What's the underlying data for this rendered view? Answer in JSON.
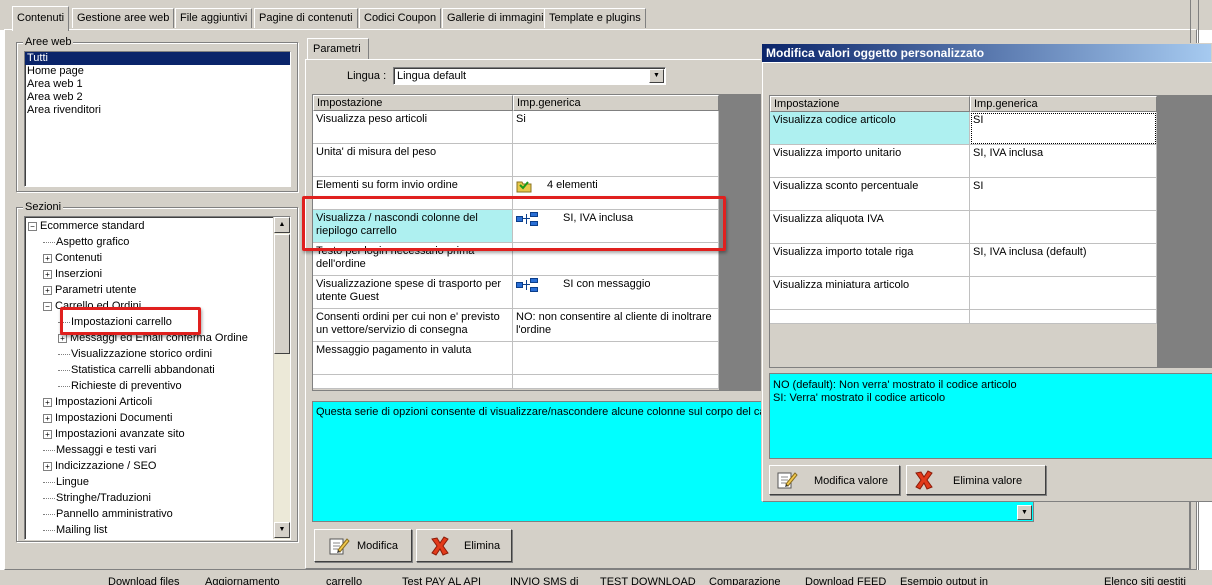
{
  "tabs": [
    "Contenuti",
    "Gestione aree web",
    "File aggiuntivi",
    "Pagine di contenuti",
    "Codici Coupon",
    "Gallerie di immagini",
    "Template e plugins"
  ],
  "aree_web": {
    "title": "Aree web",
    "items": [
      "Tutti",
      "Home page",
      "Area web 1",
      "Area web 2",
      "Area rivenditori"
    ]
  },
  "sezioni": {
    "title": "Sezioni",
    "items": [
      {
        "label": "Ecommerce standard",
        "level": 0,
        "exp": "−"
      },
      {
        "label": "Aspetto grafico",
        "level": 1,
        "exp": ""
      },
      {
        "label": "Contenuti",
        "level": 1,
        "exp": "+"
      },
      {
        "label": "Inserzioni",
        "level": 1,
        "exp": "+"
      },
      {
        "label": "Parametri utente",
        "level": 1,
        "exp": "+"
      },
      {
        "label": "Carrello ed Ordini",
        "level": 1,
        "exp": "−"
      },
      {
        "label": "Impostazioni carrello",
        "level": 2,
        "exp": ""
      },
      {
        "label": "Messaggi ed Email conferma Ordine",
        "level": 2,
        "exp": "+"
      },
      {
        "label": "Visualizzazione storico ordini",
        "level": 2,
        "exp": ""
      },
      {
        "label": "Statistica carrelli abbandonati",
        "level": 2,
        "exp": ""
      },
      {
        "label": "Richieste di preventivo",
        "level": 2,
        "exp": ""
      },
      {
        "label": "Impostazioni Articoli",
        "level": 1,
        "exp": "+"
      },
      {
        "label": "Impostazioni Documenti",
        "level": 1,
        "exp": "+"
      },
      {
        "label": "Impostazioni avanzate sito",
        "level": 1,
        "exp": "+"
      },
      {
        "label": "Messaggi e testi vari",
        "level": 1,
        "exp": ""
      },
      {
        "label": "Indicizzazione / SEO",
        "level": 1,
        "exp": "+"
      },
      {
        "label": "Lingue",
        "level": 1,
        "exp": ""
      },
      {
        "label": "Stringhe/Traduzioni",
        "level": 1,
        "exp": ""
      },
      {
        "label": "Pannello amministrativo",
        "level": 1,
        "exp": ""
      },
      {
        "label": "Mailing list",
        "level": 1,
        "exp": ""
      }
    ]
  },
  "parametri": {
    "tab": "Parametri",
    "lingua_label": "Lingua :",
    "lingua_value": "Lingua default",
    "col_impostazione": "Impostazione",
    "col_generica": "Imp.generica",
    "rows": [
      {
        "label": "Visualizza peso articoli",
        "value": "Si",
        "icon": ""
      },
      {
        "label": "Unita' di misura del peso",
        "value": "",
        "icon": ""
      },
      {
        "label": "Elementi su form invio ordine",
        "value": "4 elementi",
        "icon": "folder"
      },
      {
        "label": "Visualizza / nascondi colonne del riepilogo carrello",
        "value": "SI, IVA inclusa",
        "icon": "tree"
      },
      {
        "label": "Testo per login necessario prima dell'ordine",
        "value": "",
        "icon": ""
      },
      {
        "label": "Visualizzazione spese di trasporto per utente Guest",
        "value": "SI con messaggio",
        "icon": "tree"
      },
      {
        "label": "Consenti ordini per cui non e' previsto un vettore/servizio di consegna",
        "value": "NO: non consentire al cliente di inoltrare l'ordine",
        "icon": ""
      },
      {
        "label": "Messaggio pagamento in valuta",
        "value": "",
        "icon": ""
      }
    ],
    "description": "Questa serie di opzioni consente di visualizzare/nascondere alcune colonne sul corpo del carre",
    "btn_modifica": "Modifica",
    "btn_elimina": "Elimina"
  },
  "dialog": {
    "title": "Modifica valori oggetto personalizzato",
    "col_impostazione": "Impostazione",
    "col_generica": "Imp.generica",
    "rows": [
      {
        "label": "Visualizza codice articolo",
        "value": "SI"
      },
      {
        "label": "Visualizza importo unitario",
        "value": "SI, IVA inclusa"
      },
      {
        "label": "Visualizza sconto percentuale",
        "value": "SI"
      },
      {
        "label": "Visualizza aliquota IVA",
        "value": ""
      },
      {
        "label": "Visualizza importo totale riga",
        "value": "SI, IVA inclusa (default)"
      },
      {
        "label": "Visualizza miniatura articolo",
        "value": ""
      }
    ],
    "help_line1": "NO (default): Non verra' mostrato il codice articolo",
    "help_line2": "SI: Verra' mostrato il codice articolo",
    "btn_modifica": "Modifica valore",
    "btn_elimina": "Elimina valore"
  },
  "bottom_strip": [
    "Download files",
    "Aggiornamento",
    "carrello",
    "Test PAY AL API",
    "INVIO SMS di",
    "TEST DOWNLOAD",
    "Comparazione",
    "Download FEED",
    "Esempio output in",
    "Elenco siti gestiti"
  ]
}
